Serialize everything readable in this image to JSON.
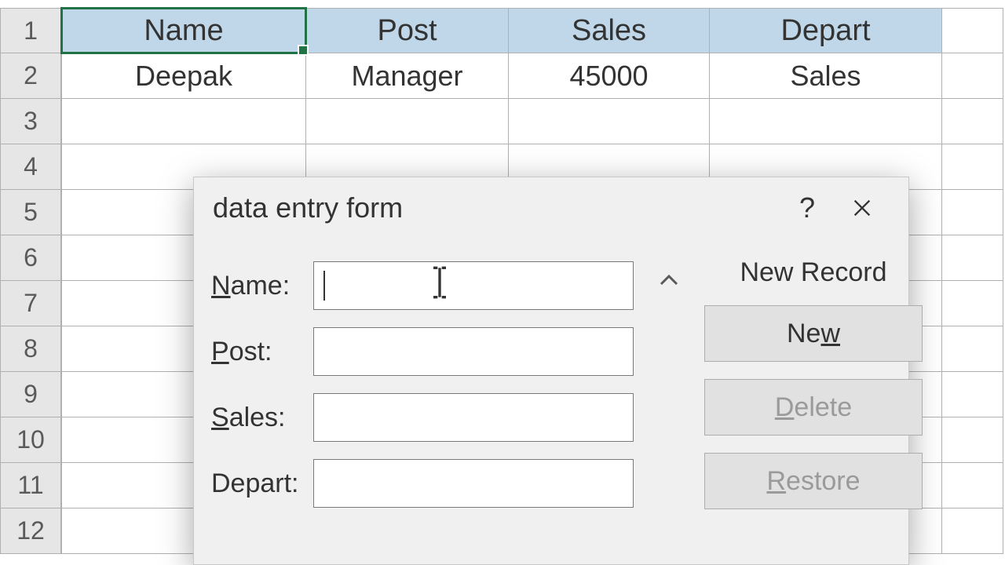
{
  "spreadsheet": {
    "row_numbers": [
      "1",
      "2",
      "3",
      "4",
      "5",
      "6",
      "7",
      "8",
      "9",
      "10",
      "11",
      "12"
    ],
    "headers": {
      "A": "Name",
      "B": "Post",
      "C": "Sales",
      "D": "Depart"
    },
    "row2": {
      "A": "Deepak",
      "B": "Manager",
      "C": "45000",
      "D": "Sales"
    }
  },
  "dialog": {
    "title": "data entry form",
    "fields": {
      "name_label": "Name:",
      "post_label": "Post:",
      "sales_label": "Sales:",
      "depart_label": "Depart:",
      "name_value": "",
      "post_value": "",
      "sales_value": "",
      "depart_value": ""
    },
    "status": "New Record",
    "buttons": {
      "new": "New",
      "delete": "Delete",
      "restore": "Restore"
    }
  }
}
